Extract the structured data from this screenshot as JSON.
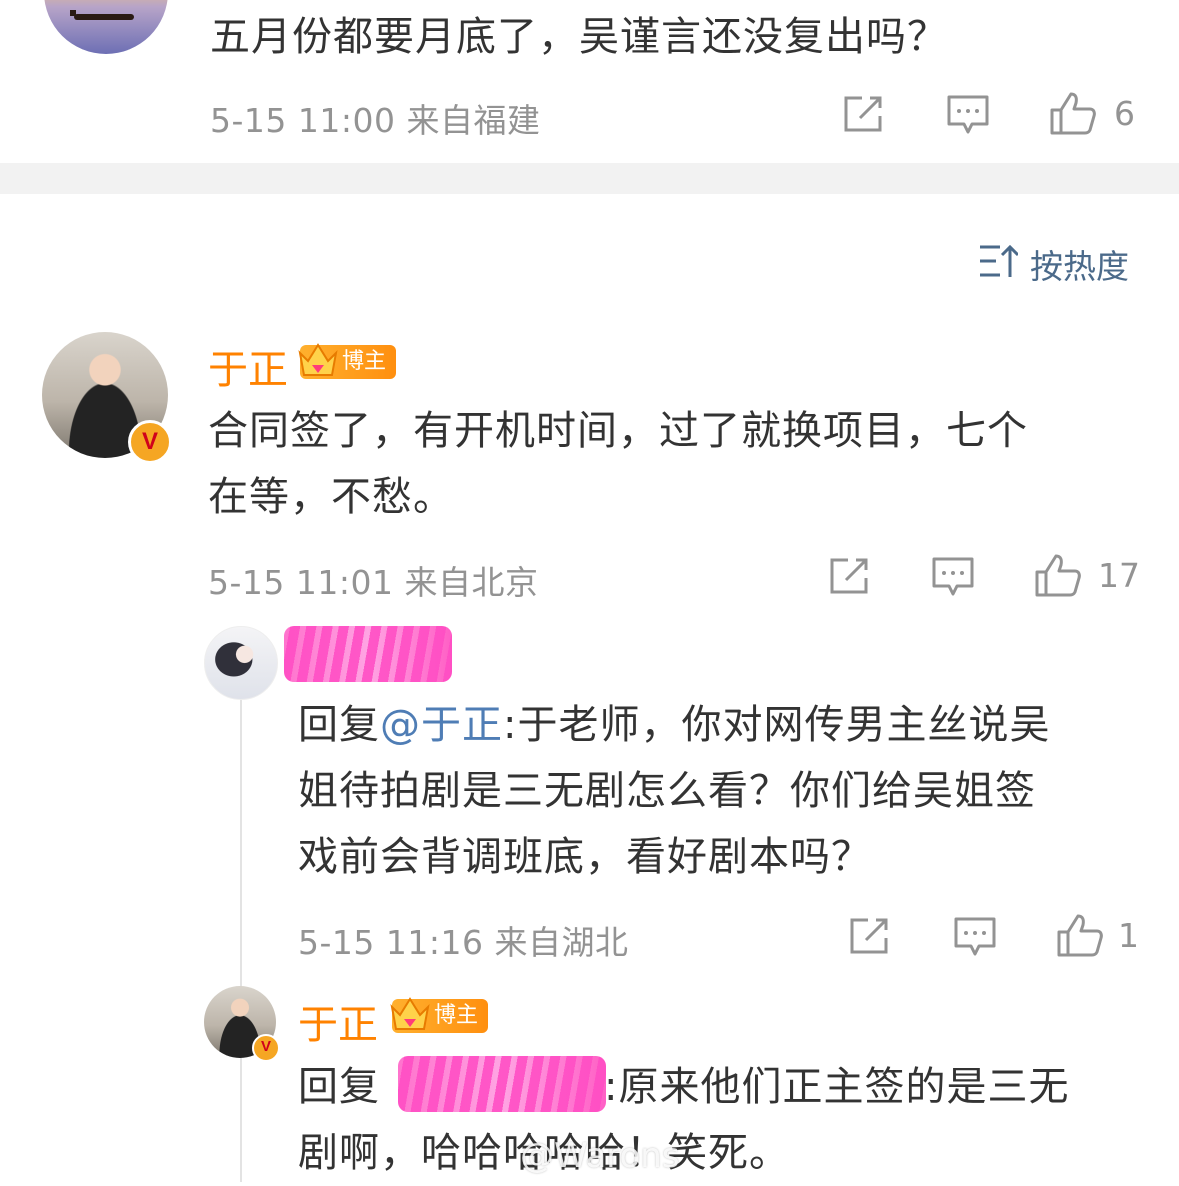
{
  "comment_top": {
    "text": "五月份都要月底了，吴谨言还没复出吗？",
    "meta": "5-15 11:00 来自福建",
    "likes": "6"
  },
  "sort": {
    "label": "按热度"
  },
  "comment_main": {
    "username": "于正",
    "badge_label": "博主",
    "text_line1": "合同签了，有开机时间，过了就换项目，七个",
    "text_line2": "在等，不愁。",
    "meta": "5-15 11:01 来自北京",
    "likes": "17"
  },
  "reply_1": {
    "reply_prefix": "回复",
    "mention": "@于正",
    "text_line1_rest": ":于老师，你对网传男主丝说吴",
    "text_line2": "姐待拍剧是三无剧怎么看？你们给吴姐签",
    "text_line3": "戏前会背调班底，看好剧本吗？",
    "meta": "5-15 11:16 来自湖北",
    "likes": "1"
  },
  "reply_2": {
    "username": "于正",
    "badge_label": "博主",
    "reply_prefix": "回复",
    "text_line1_rest": ":原来他们正主签的是三无",
    "text_line2": "剧啊，哈哈哈哈哈！笑死。"
  },
  "watermark": {
    "text": "@Warons"
  },
  "icons": {
    "share": "share-icon",
    "comment": "comment-icon",
    "like": "thumbs-up-icon",
    "sort": "sort-icon",
    "verified": "verified-v-icon",
    "crown": "crown-icon"
  },
  "colors": {
    "username": "#ff8200",
    "mention": "#4f7db5",
    "meta": "#939393",
    "sort": "#4b6a8a",
    "badge": "#ff8f0f"
  }
}
